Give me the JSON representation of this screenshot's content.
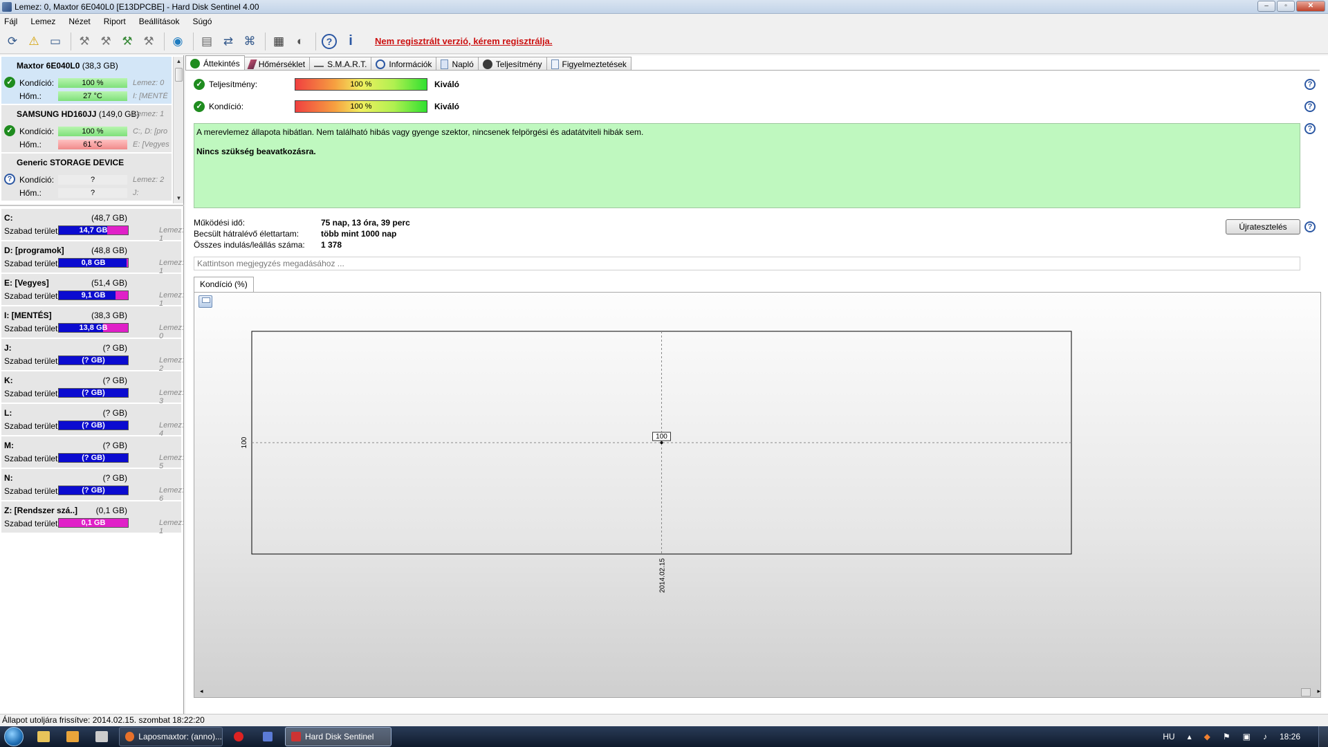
{
  "window": {
    "title": "Lemez: 0, Maxtor 6E040L0 [E13DPCBE]  -  Hard Disk Sentinel 4.00",
    "buttons": [
      "–",
      "▫",
      "✕"
    ]
  },
  "menu": [
    "Fájl",
    "Lemez",
    "Nézet",
    "Riport",
    "Beállítások",
    "Súgó"
  ],
  "toolbar": {
    "register_text": "Nem regisztrált verzió, kérem regisztrálja.",
    "icons": [
      "refresh-icon",
      "alert-icon",
      "disk-icon",
      "tool-icon-1",
      "tool-icon-2",
      "tool-icon-3",
      "tool-icon-4",
      "globe-icon",
      "report-icon",
      "sync-icon",
      "network-icon",
      "chart-icon",
      "gauge-icon",
      "help-icon",
      "info-icon"
    ]
  },
  "disks": [
    {
      "name": "Maxtor 6E040L0",
      "size": "(38,3 GB)",
      "status": "ok",
      "cond_label": "Kondíció:",
      "cond_value": "100 %",
      "cond_color": "green",
      "cond_side": "Lemez: 0",
      "temp_label": "Hőm.:",
      "temp_value": "27 °C",
      "temp_color": "green",
      "temp_side": "I: [MENTÉ"
    },
    {
      "name": "SAMSUNG HD160JJ",
      "size": "(149,0 GB)",
      "status": "ok",
      "cond_label": "Kondíció:",
      "cond_value": "100 %",
      "cond_color": "green",
      "cond_side": "C:, D: [pro",
      "temp_label": "Hőm.:",
      "temp_value": "61 °C",
      "temp_color": "red",
      "temp_side": "E: [Vegyes",
      "side_top": "Lemez: 1"
    },
    {
      "name": "Generic STORAGE DEVICE",
      "size": "",
      "status": "unknown",
      "cond_label": "Kondíció:",
      "cond_value": "?",
      "cond_color": "grey",
      "cond_side": "Lemez: 2",
      "temp_label": "Hőm.:",
      "temp_value": "?",
      "temp_color": "grey",
      "temp_side": "J:"
    }
  ],
  "volumes": [
    {
      "name": "C:",
      "size": "(48,7 GB)",
      "free_label": "Szabad terület",
      "free": "14,7 GB",
      "free_pct": 0.3,
      "disk": "Lemez: 1"
    },
    {
      "name": "D: [programok]",
      "size": "(48,8 GB)",
      "free_label": "Szabad terület",
      "free": "0,8 GB",
      "free_pct": 0.02,
      "disk": "Lemez: 1"
    },
    {
      "name": "E: [Vegyes]",
      "size": "(51,4 GB)",
      "free_label": "Szabad terület",
      "free": "9,1 GB",
      "free_pct": 0.18,
      "disk": "Lemez: 1"
    },
    {
      "name": "I: [MENTÉS]",
      "size": "(38,3 GB)",
      "free_label": "Szabad terület",
      "free": "13,8 GB",
      "free_pct": 0.36,
      "disk": "Lemez: 0"
    },
    {
      "name": "J:",
      "size": "(? GB)",
      "free_label": "Szabad terület",
      "free": "(? GB)",
      "free_pct": 0,
      "disk": "Lemez: 2"
    },
    {
      "name": "K:",
      "size": "(? GB)",
      "free_label": "Szabad terület",
      "free": "(? GB)",
      "free_pct": 0,
      "disk": "Lemez: 3"
    },
    {
      "name": "L:",
      "size": "(? GB)",
      "free_label": "Szabad terület",
      "free": "(? GB)",
      "free_pct": 0,
      "disk": "Lemez: 4"
    },
    {
      "name": "M:",
      "size": "(? GB)",
      "free_label": "Szabad terület",
      "free": "(? GB)",
      "free_pct": 0,
      "disk": "Lemez: 5"
    },
    {
      "name": "N:",
      "size": "(? GB)",
      "free_label": "Szabad terület",
      "free": "(? GB)",
      "free_pct": 0,
      "disk": "Lemez: 6"
    },
    {
      "name": "Z: [Rendszer szá..]",
      "size": "(0,1 GB)",
      "free_label": "Szabad terület",
      "free": "0,1 GB",
      "free_pct": 1.0,
      "disk": "Lemez: 1"
    }
  ],
  "tabs": [
    "Áttekintés",
    "Hőmérséklet",
    "S.M.A.R.T.",
    "Információk",
    "Napló",
    "Teljesítmény",
    "Figyelmeztetések"
  ],
  "overview": {
    "performance_label": "Teljesítmény:",
    "performance_value": "100 %",
    "performance_rating": "Kiváló",
    "health_label": "Kondíció:",
    "health_value": "100 %",
    "health_rating": "Kiváló",
    "status_message": "A merevlemez állapota hibátlan. Nem található hibás vagy gyenge szektor, nincsenek felpörgési és adatátviteli hibák sem.",
    "status_action": "Nincs szükség beavatkozásra.",
    "stats": [
      {
        "label": "Működési idő:",
        "value": "75 nap, 13 óra, 39 perc"
      },
      {
        "label": "Becsült hátralévő élettartam:",
        "value": "több mint 1000 nap"
      },
      {
        "label": "Összes indulás/leállás száma:",
        "value": "1 378"
      }
    ],
    "retest_label": "Újratesztelés",
    "note_placeholder": "Kattintson megjegyzés megadásához ...",
    "chart_tab": "Kondíció  (%)"
  },
  "chart_data": {
    "type": "line",
    "x": [
      "2014.02.15"
    ],
    "series": [
      {
        "values": [
          100
        ]
      }
    ],
    "data_labels": [
      "100"
    ],
    "ytick": "100"
  },
  "statusbar": "Állapot utoljára frissítve: 2014.02.15. szombat 18:22:20",
  "taskbar": {
    "items": [
      {
        "label": "Laposmaxtor: (anno)...",
        "active": false
      },
      {
        "label": "Hard Disk Sentinel",
        "active": true
      }
    ],
    "lang": "HU",
    "clock": "18:26"
  }
}
